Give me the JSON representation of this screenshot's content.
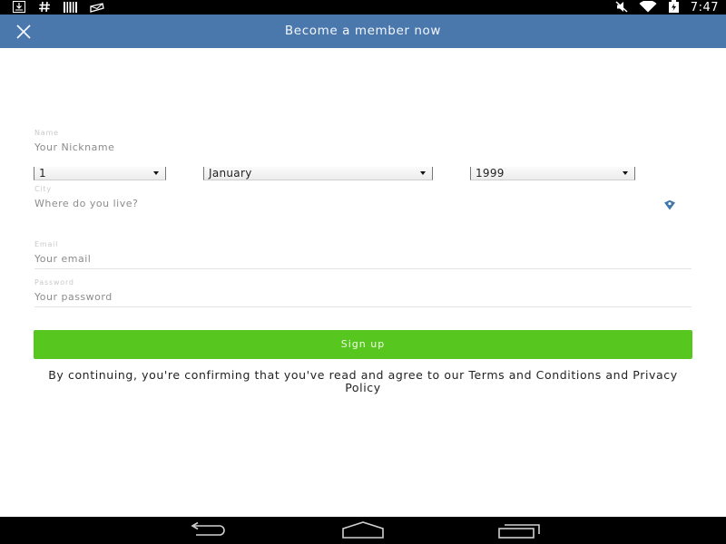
{
  "status_bar": {
    "time": "7:47",
    "left_icons": [
      "download-icon",
      "hash-icon",
      "barcode-icon",
      "mail-icon"
    ],
    "right_icons": [
      "mute-icon",
      "wifi-icon",
      "battery-icon"
    ]
  },
  "app_bar": {
    "title": "Become a member now",
    "close_icon": "close-icon",
    "background": "#4a78ad"
  },
  "form": {
    "name": {
      "label": "Name",
      "placeholder": "Your Nickname"
    },
    "birth_day": {
      "value": "1"
    },
    "birth_month": {
      "value": "January"
    },
    "birth_year": {
      "value": "1999"
    },
    "city": {
      "label": "City",
      "placeholder": "Where do you live?",
      "icon": "location-pin-icon"
    },
    "email": {
      "label": "Email",
      "placeholder": "Your email"
    },
    "password": {
      "label": "Password",
      "placeholder": "Your password"
    },
    "signup_label": "Sign up",
    "signup_color": "#57c61f",
    "legal_text": "By continuing, you're confirming that you've read and agree to our Terms and Conditions and Privacy Policy"
  },
  "nav_bar": {
    "items": [
      "back-icon",
      "home-icon",
      "recent-apps-icon"
    ]
  }
}
